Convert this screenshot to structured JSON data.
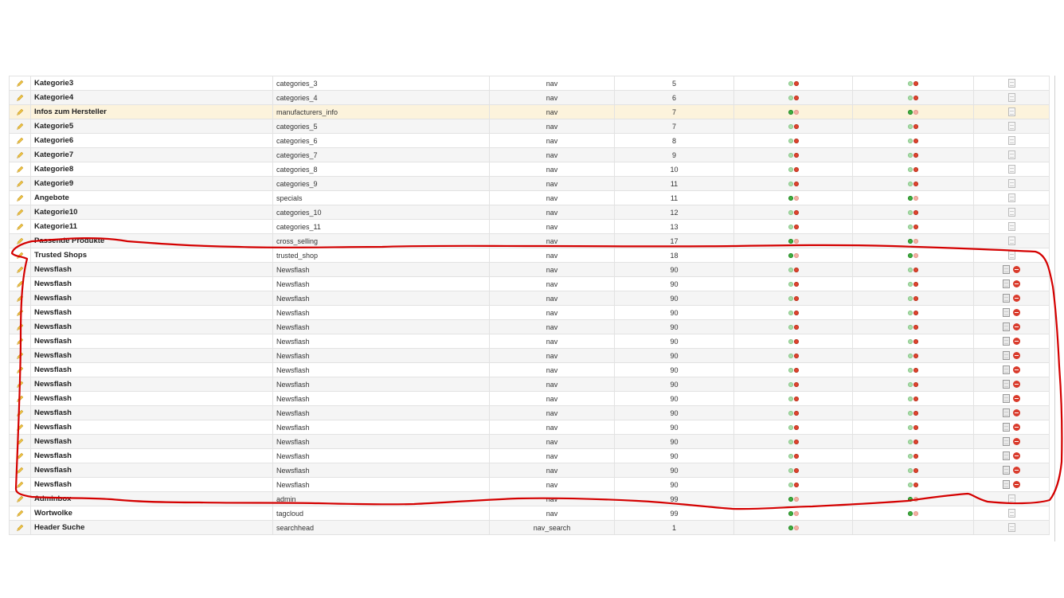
{
  "table": {
    "rows": [
      {
        "name": "Kategorie3",
        "key": "categories_3",
        "position": "nav",
        "sort": "5",
        "status1": "off",
        "status2": "off",
        "actions": "doc"
      },
      {
        "name": "Kategorie4",
        "key": "categories_4",
        "position": "nav",
        "sort": "6",
        "status1": "off",
        "status2": "off",
        "actions": "doc"
      },
      {
        "name": "Infos zum Hersteller",
        "key": "manufacturers_info",
        "position": "nav",
        "sort": "7",
        "status1": "on",
        "status2": "on",
        "actions": "doc"
      },
      {
        "name": "Kategorie5",
        "key": "categories_5",
        "position": "nav",
        "sort": "7",
        "status1": "off",
        "status2": "off",
        "actions": "doc"
      },
      {
        "name": "Kategorie6",
        "key": "categories_6",
        "position": "nav",
        "sort": "8",
        "status1": "off",
        "status2": "off",
        "actions": "doc"
      },
      {
        "name": "Kategorie7",
        "key": "categories_7",
        "position": "nav",
        "sort": "9",
        "status1": "off",
        "status2": "off",
        "actions": "doc"
      },
      {
        "name": "Kategorie8",
        "key": "categories_8",
        "position": "nav",
        "sort": "10",
        "status1": "off",
        "status2": "off",
        "actions": "doc"
      },
      {
        "name": "Kategorie9",
        "key": "categories_9",
        "position": "nav",
        "sort": "11",
        "status1": "off",
        "status2": "off",
        "actions": "doc"
      },
      {
        "name": "Angebote",
        "key": "specials",
        "position": "nav",
        "sort": "11",
        "status1": "on",
        "status2": "on",
        "actions": "doc"
      },
      {
        "name": "Kategorie10",
        "key": "categories_10",
        "position": "nav",
        "sort": "12",
        "status1": "off",
        "status2": "off",
        "actions": "doc"
      },
      {
        "name": "Kategorie11",
        "key": "categories_11",
        "position": "nav",
        "sort": "13",
        "status1": "off",
        "status2": "off",
        "actions": "doc"
      },
      {
        "name": "Passende Produkte",
        "key": "cross_selling",
        "position": "nav",
        "sort": "17",
        "status1": "on",
        "status2": "on",
        "actions": "doc"
      },
      {
        "name": "Trusted Shops",
        "key": "trusted_shop",
        "position": "nav",
        "sort": "18",
        "status1": "on",
        "status2": "on",
        "actions": "doc"
      },
      {
        "name": "Newsflash",
        "key": "Newsflash",
        "position": "nav",
        "sort": "90",
        "status1": "off",
        "status2": "off",
        "actions": "doc-delete"
      },
      {
        "name": "Newsflash",
        "key": "Newsflash",
        "position": "nav",
        "sort": "90",
        "status1": "off",
        "status2": "off",
        "actions": "doc-delete"
      },
      {
        "name": "Newsflash",
        "key": "Newsflash",
        "position": "nav",
        "sort": "90",
        "status1": "off",
        "status2": "off",
        "actions": "doc-delete"
      },
      {
        "name": "Newsflash",
        "key": "Newsflash",
        "position": "nav",
        "sort": "90",
        "status1": "off",
        "status2": "off",
        "actions": "doc-delete"
      },
      {
        "name": "Newsflash",
        "key": "Newsflash",
        "position": "nav",
        "sort": "90",
        "status1": "off",
        "status2": "off",
        "actions": "doc-delete"
      },
      {
        "name": "Newsflash",
        "key": "Newsflash",
        "position": "nav",
        "sort": "90",
        "status1": "off",
        "status2": "off",
        "actions": "doc-delete"
      },
      {
        "name": "Newsflash",
        "key": "Newsflash",
        "position": "nav",
        "sort": "90",
        "status1": "off",
        "status2": "off",
        "actions": "doc-delete"
      },
      {
        "name": "Newsflash",
        "key": "Newsflash",
        "position": "nav",
        "sort": "90",
        "status1": "off",
        "status2": "off",
        "actions": "doc-delete"
      },
      {
        "name": "Newsflash",
        "key": "Newsflash",
        "position": "nav",
        "sort": "90",
        "status1": "off",
        "status2": "off",
        "actions": "doc-delete"
      },
      {
        "name": "Newsflash",
        "key": "Newsflash",
        "position": "nav",
        "sort": "90",
        "status1": "off",
        "status2": "off",
        "actions": "doc-delete"
      },
      {
        "name": "Newsflash",
        "key": "Newsflash",
        "position": "nav",
        "sort": "90",
        "status1": "off",
        "status2": "off",
        "actions": "doc-delete"
      },
      {
        "name": "Newsflash",
        "key": "Newsflash",
        "position": "nav",
        "sort": "90",
        "status1": "off",
        "status2": "off",
        "actions": "doc-delete"
      },
      {
        "name": "Newsflash",
        "key": "Newsflash",
        "position": "nav",
        "sort": "90",
        "status1": "off",
        "status2": "off",
        "actions": "doc-delete"
      },
      {
        "name": "Newsflash",
        "key": "Newsflash",
        "position": "nav",
        "sort": "90",
        "status1": "off",
        "status2": "off",
        "actions": "doc-delete"
      },
      {
        "name": "Newsflash",
        "key": "Newsflash",
        "position": "nav",
        "sort": "90",
        "status1": "off",
        "status2": "off",
        "actions": "doc-delete"
      },
      {
        "name": "Newsflash",
        "key": "Newsflash",
        "position": "nav",
        "sort": "90",
        "status1": "off",
        "status2": "off",
        "actions": "doc-delete"
      },
      {
        "name": "Adminbox",
        "key": "admin",
        "position": "nav",
        "sort": "99",
        "status1": "on",
        "status2": "on",
        "actions": "doc"
      },
      {
        "name": "Wortwolke",
        "key": "tagcloud",
        "position": "nav",
        "sort": "99",
        "status1": "on",
        "status2": "on",
        "actions": "doc"
      },
      {
        "name": "Header Suche",
        "key": "searchhead",
        "position": "nav_search",
        "sort": "1",
        "status1": "on",
        "status2": "",
        "actions": "doc"
      }
    ],
    "highlighted_row_index": 2
  },
  "annotation": {
    "color": "#d40000",
    "kind": "hand-drawn-outline"
  },
  "colors": {
    "status_green": "#3fae3f",
    "status_red": "#e0452e",
    "row_highlight": "#fcf3dc"
  }
}
